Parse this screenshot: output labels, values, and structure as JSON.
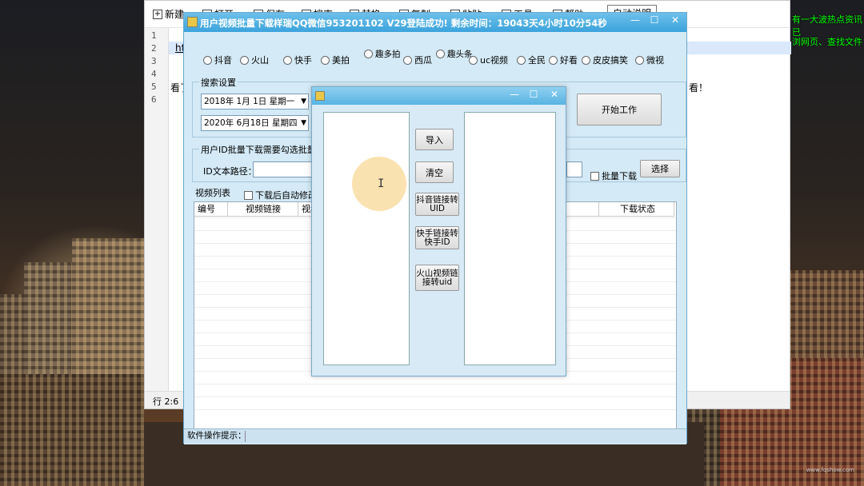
{
  "notepad": {
    "toolbar": [
      {
        "icon": "plus-icon",
        "label": "新建"
      },
      {
        "icon": "folder-icon",
        "label": "打开"
      },
      {
        "icon": "save-icon",
        "label": "保存"
      },
      {
        "icon": "search-icon",
        "label": "搜索"
      },
      {
        "icon": "replace-icon",
        "label": "替换"
      },
      {
        "icon": "copy-icon",
        "label": "复制"
      },
      {
        "icon": "paste-icon",
        "label": "粘贴"
      },
      {
        "icon": "tool-icon",
        "label": "工具"
      },
      {
        "icon": "help-icon",
        "label": "帮助"
      }
    ],
    "line_numbers": [
      "1",
      "2",
      "3",
      "4",
      "5",
      "6"
    ],
    "line2_text": "ht",
    "line5_text": "看了",
    "line5_tail": "看！",
    "status_text": "行 2:6",
    "top_right_button": "自动说明"
  },
  "external_text": {
    "line1": "有一大波热点资讯已",
    "line2": "浏网页、查找文件"
  },
  "app": {
    "title": "用户视频批量下载样瑞QQ微信953201102    V29登陆成功! 剩余时间：19043天4小时10分54秒",
    "platforms": [
      {
        "label": "抖音",
        "stack": false
      },
      {
        "label": "火山",
        "stack": false
      },
      {
        "label": "快手",
        "stack": false
      },
      {
        "label": "美拍",
        "stack": false
      },
      {
        "label": "趣多拍",
        "stack": true
      },
      {
        "label": "西瓜",
        "stack": false
      },
      {
        "label": "趣头条",
        "stack": true
      },
      {
        "label": "uc视频",
        "stack": false
      },
      {
        "label": "全民",
        "stack": false
      },
      {
        "label": "好看",
        "stack": false
      },
      {
        "label": "皮皮搞笑",
        "stack": false
      },
      {
        "label": "微视",
        "stack": false
      }
    ],
    "search_group_label": "搜索设置",
    "start_date": "2018年  1月  1日  星期一",
    "end_date": "2020年  6月18日  星期四",
    "start_button": "开始工作",
    "batch_group_label": "用户ID批量下载需要勾选批量下",
    "id_path_label": "ID文本路径：",
    "batch_download_label": "批量下载",
    "select_button": "选择",
    "video_list_label": "视频列表",
    "auto_modify_label": "下载后自动修改",
    "columns": [
      "编号",
      "视频链接",
      "视频",
      "下载状态"
    ],
    "status_label": "软件操作提示："
  },
  "dialog": {
    "import_button": "导入",
    "clear_button": "清空",
    "douyin_button_l1": "抖音链接转",
    "douyin_button_l2": "UID",
    "kuaishou_button_l1": "快手链接转",
    "kuaishou_button_l2": "快手ID",
    "huoshan_button_l1": "火山视频链",
    "huoshan_button_l2": "接转uid"
  },
  "watermark": "www.fqshow.com"
}
